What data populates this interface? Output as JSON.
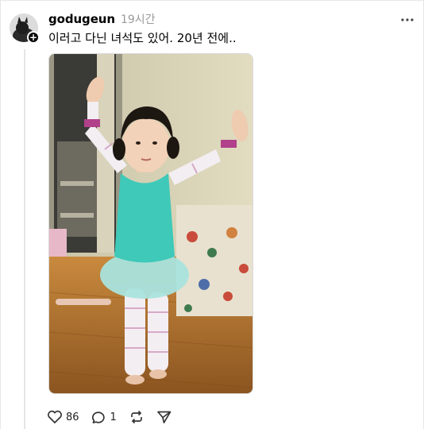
{
  "post": {
    "username": "godugeun",
    "time": "19시간",
    "text": "이러고 다닌 녀석도 있어. 20년 전에..",
    "likes": "86",
    "replies": "1"
  },
  "icons": {
    "more": "more-horizontal-icon",
    "like": "heart-icon",
    "reply": "comment-icon",
    "repost": "repost-icon",
    "share": "send-icon",
    "follow": "plus-icon"
  },
  "colors": {
    "leotard": "#3fc9b8",
    "floor": "#b8782e",
    "muted_text": "#9a9a9a"
  }
}
